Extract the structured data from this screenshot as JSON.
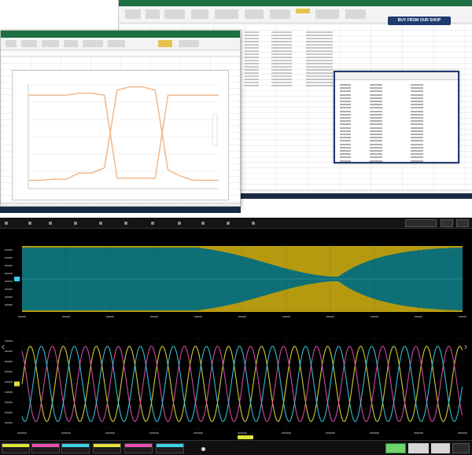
{
  "back_excel": {
    "badge_text": "BUY FROM OUR SHOP",
    "ribbon_color": "#1d6f42"
  },
  "front_excel": {
    "ribbon_color": "#1d6f42",
    "chart": {
      "type": "line",
      "title": "",
      "xlabel": "",
      "ylabel": "",
      "series": [
        {
          "color": "#f0b383",
          "values": [
            0.9,
            0.9,
            0.9,
            0.9,
            0.92,
            0.92,
            0.9,
            0.1,
            0.1,
            0.1,
            0.1,
            0.9,
            0.9,
            0.9,
            0.9,
            0.9
          ]
        },
        {
          "color": "#f0b383",
          "values": [
            0.08,
            0.08,
            0.09,
            0.09,
            0.15,
            0.15,
            0.2,
            0.95,
            0.98,
            0.98,
            0.95,
            0.18,
            0.12,
            0.08,
            0.08,
            0.08
          ]
        }
      ]
    }
  },
  "scope": {
    "colors": {
      "yellow": "#b59a10",
      "teal": "#0e6f77",
      "background": "#000000"
    },
    "menu_icon_names": [
      "file-icon",
      "vertical-icon",
      "timebase-icon",
      "trigger-icon",
      "display-icon",
      "cursors-icon",
      "measure-icon",
      "math-icon",
      "analysis-icon",
      "utilities-icon",
      "support-icon"
    ]
  }
}
